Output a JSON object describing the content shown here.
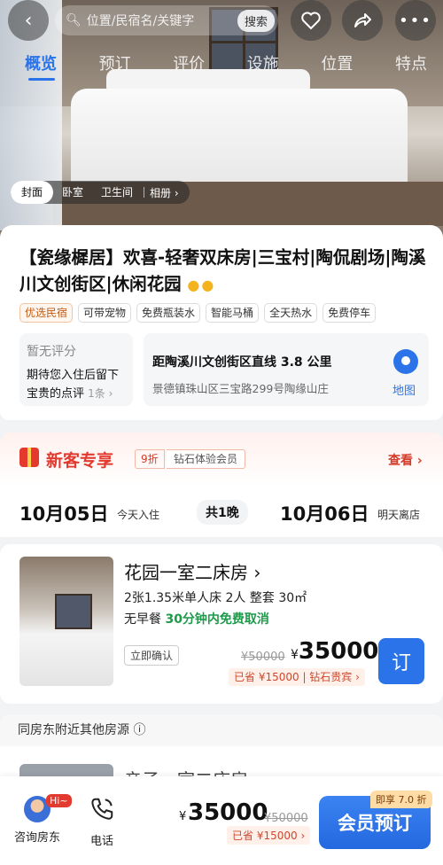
{
  "search": {
    "placeholder": "位置/民宿名/关键字",
    "button": "搜索"
  },
  "tabs": [
    "概览",
    "预订",
    "评价",
    "设施",
    "位置",
    "特点"
  ],
  "photo_tabs": {
    "items": [
      "封面",
      "卧室",
      "卫生间"
    ],
    "album": "相册 ›"
  },
  "listing": {
    "title": "【瓷缘樨居】欢喜-轻奢双床房|三宝村|陶侃剧场|陶溪川文创街区|休闲花园",
    "dots": "●●",
    "tags": [
      "优选民宿",
      "可带宠物",
      "免费瓶装水",
      "智能马桶",
      "全天热水",
      "免费停车"
    ]
  },
  "review": {
    "title": "暂无评分",
    "text": "期待您入住后留下宝贵的点评",
    "count": "1条 ›"
  },
  "location": {
    "main": "距陶溪川文创街区直线 3.8 公里",
    "address": "景德镇珠山区三宝路299号陶缘山庄",
    "map_label": "地图"
  },
  "promo": {
    "title": "新客专享",
    "discount": "9折",
    "member": "钻石体验会员",
    "more": "查看 ›"
  },
  "dates": {
    "checkin": "10月05日",
    "checkin_note": "今天入住",
    "nights": "共1晚",
    "checkout": "10月06日",
    "checkout_note": "明天离店"
  },
  "room": {
    "name": "花园一室二床房 ›",
    "specs": "2张1.35米单人床 2人 整套 30㎡",
    "meal": "无早餐",
    "cancel": "30分钟内免费取消",
    "confirm": "立即确认",
    "price_old": "¥50000",
    "currency": "¥",
    "price": "35000",
    "saving": "已省 ¥15000 | 钻石贵宾 ›",
    "book": "订"
  },
  "nearby": {
    "title": "同房东附近其他房源 ⓘ",
    "peek_name": "亲子一室二床房"
  },
  "bottom": {
    "hi": "Hi~",
    "chat": "咨询房东",
    "phone": "电话",
    "currency": "¥",
    "price": "35000",
    "price_old": "¥50000",
    "saving": "已省 ¥15000 ›",
    "member_discount": "即享 7.0 折",
    "member_book": "会员预订"
  }
}
